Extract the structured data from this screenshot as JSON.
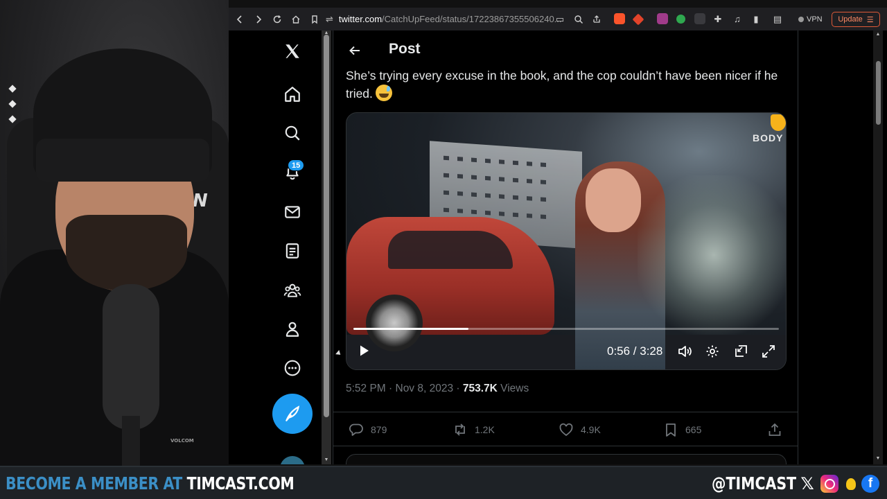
{
  "browser": {
    "url_domain": "twitter.com",
    "url_path": "/CatchUpFeed/status/17223867355506240...",
    "vpn_label": "VPN",
    "update_label": "Update",
    "brave_badge": "2",
    "alert_badge": "1"
  },
  "webcam": {
    "chair_logo": "N",
    "mic_brand": "VOLCOM"
  },
  "sidebar": {
    "notifications_count": "15"
  },
  "post": {
    "header_title": "Post",
    "text": "She’s trying every excuse in the book, and the cop couldn’t have been nicer if he tried.",
    "video": {
      "overlay_label": "BODY",
      "current_time": "0:56",
      "duration": "3:28",
      "time_display": "0:56 / 3:28",
      "progress": 0.27
    },
    "timestamp": "5:52 PM · Nov 8, 2023 ·",
    "views_count": "753.7K",
    "views_label": "Views",
    "replies": "879",
    "reposts": "1.2K",
    "likes": "4.9K",
    "bookmarks": "665"
  },
  "banner": {
    "cta_prefix": "BECOME A MEMBER AT",
    "cta_site": "TIMCAST.COM",
    "handle": "@TIMCAST",
    "x_glyph": "𝕏",
    "fb_glyph": "f"
  },
  "colors": {
    "accent": "#1d9bf0",
    "banner_blue": "#3b8fc6",
    "update_orange": "#e05a38"
  }
}
